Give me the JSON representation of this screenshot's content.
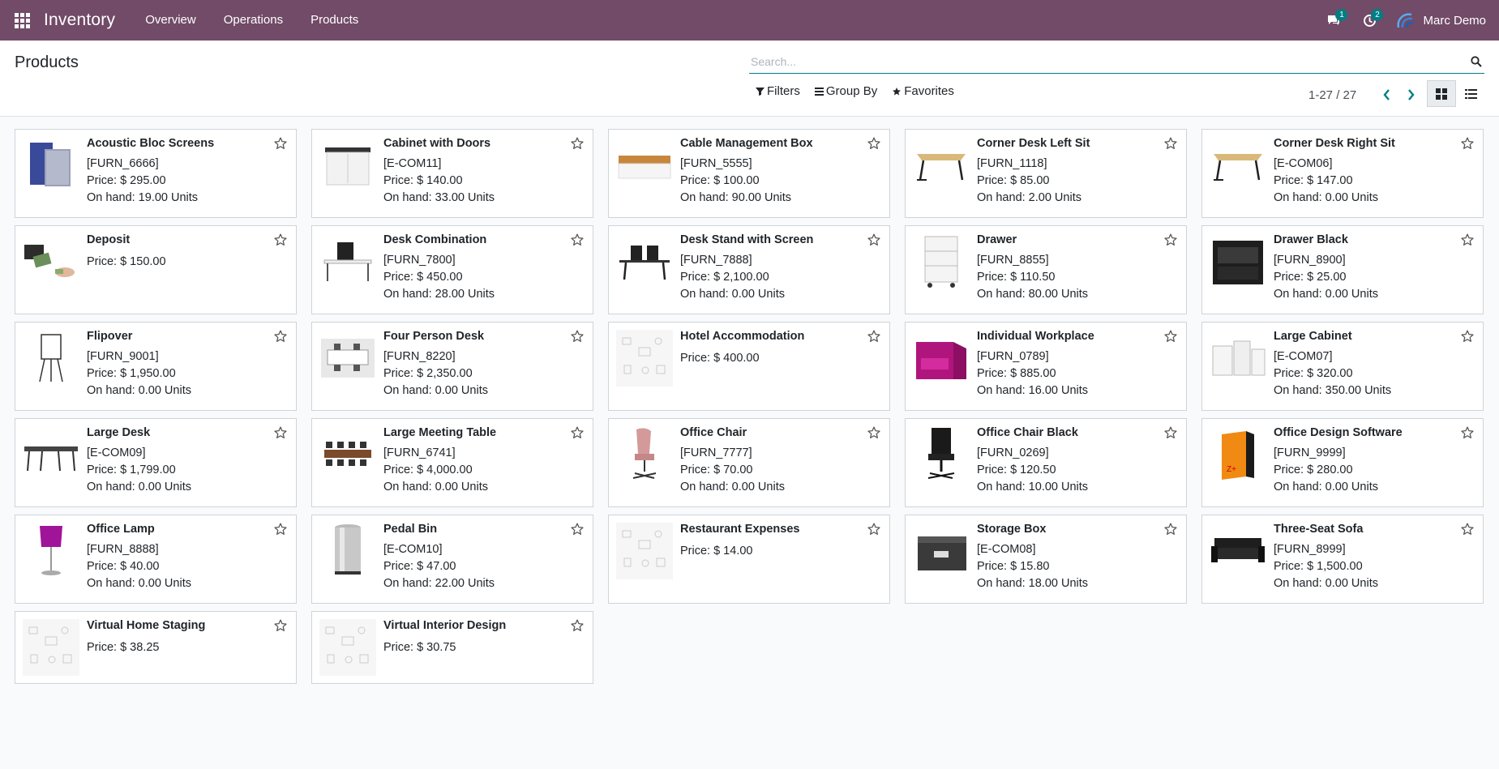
{
  "navbar": {
    "app_name": "Inventory",
    "menu": [
      "Overview",
      "Operations",
      "Products"
    ],
    "messages_count": "1",
    "activities_count": "2",
    "user_name": "Marc Demo",
    "bg_color": "#714b67",
    "badge_color": "#017e84"
  },
  "control_panel": {
    "title": "Products",
    "search_placeholder": "Search...",
    "filters_label": "Filters",
    "group_by_label": "Group By",
    "favorites_label": "Favorites",
    "pager_value": "1-27 / 27"
  },
  "products": [
    {
      "name": "Acoustic Bloc Screens",
      "ref": "[FURN_6666]",
      "price": "Price: $ 295.00",
      "onhand": "On hand: 19.00 Units",
      "icon": "acoustic-screen-image"
    },
    {
      "name": "Cabinet with Doors",
      "ref": "[E-COM11]",
      "price": "Price: $ 140.00",
      "onhand": "On hand: 33.00 Units",
      "icon": "cabinet-image"
    },
    {
      "name": "Cable Management Box",
      "ref": "[FURN_5555]",
      "price": "Price: $ 100.00",
      "onhand": "On hand: 90.00 Units",
      "icon": "cable-box-image"
    },
    {
      "name": "Corner Desk Left Sit",
      "ref": "[FURN_1118]",
      "price": "Price: $ 85.00",
      "onhand": "On hand: 2.00 Units",
      "icon": "desk-image"
    },
    {
      "name": "Corner Desk Right Sit",
      "ref": "[E-COM06]",
      "price": "Price: $ 147.00",
      "onhand": "On hand: 0.00 Units",
      "icon": "desk-image"
    },
    {
      "name": "Deposit",
      "ref": "",
      "price": "Price: $ 150.00",
      "onhand": "",
      "icon": "money-image"
    },
    {
      "name": "Desk Combination",
      "ref": "[FURN_7800]",
      "price": "Price: $ 450.00",
      "onhand": "On hand: 28.00 Units",
      "icon": "desk-combo-image"
    },
    {
      "name": "Desk Stand with Screen",
      "ref": "[FURN_7888]",
      "price": "Price: $ 2,100.00",
      "onhand": "On hand: 0.00 Units",
      "icon": "desk-screen-image"
    },
    {
      "name": "Drawer",
      "ref": "[FURN_8855]",
      "price": "Price: $ 110.50",
      "onhand": "On hand: 80.00 Units",
      "icon": "drawer-image"
    },
    {
      "name": "Drawer Black",
      "ref": "[FURN_8900]",
      "price": "Price: $ 25.00",
      "onhand": "On hand: 0.00 Units",
      "icon": "drawer-black-image"
    },
    {
      "name": "Flipover",
      "ref": "[FURN_9001]",
      "price": "Price: $ 1,950.00",
      "onhand": "On hand: 0.00 Units",
      "icon": "flipchart-image"
    },
    {
      "name": "Four Person Desk",
      "ref": "[FURN_8220]",
      "price": "Price: $ 2,350.00",
      "onhand": "On hand: 0.00 Units",
      "icon": "four-desk-image"
    },
    {
      "name": "Hotel Accommodation",
      "ref": "",
      "price": "Price: $ 400.00",
      "onhand": "",
      "icon": "placeholder-image"
    },
    {
      "name": "Individual Workplace",
      "ref": "[FURN_0789]",
      "price": "Price: $ 885.00",
      "onhand": "On hand: 16.00 Units",
      "icon": "workplace-image"
    },
    {
      "name": "Large Cabinet",
      "ref": "[E-COM07]",
      "price": "Price: $ 320.00",
      "onhand": "On hand: 350.00 Units",
      "icon": "large-cabinet-image"
    },
    {
      "name": "Large Desk",
      "ref": "[E-COM09]",
      "price": "Price: $ 1,799.00",
      "onhand": "On hand: 0.00 Units",
      "icon": "large-desk-image"
    },
    {
      "name": "Large Meeting Table",
      "ref": "[FURN_6741]",
      "price": "Price: $ 4,000.00",
      "onhand": "On hand: 0.00 Units",
      "icon": "meeting-table-image"
    },
    {
      "name": "Office Chair",
      "ref": "[FURN_7777]",
      "price": "Price: $ 70.00",
      "onhand": "On hand: 0.00 Units",
      "icon": "chair-pink-image"
    },
    {
      "name": "Office Chair Black",
      "ref": "[FURN_0269]",
      "price": "Price: $ 120.50",
      "onhand": "On hand: 10.00 Units",
      "icon": "chair-black-image"
    },
    {
      "name": "Office Design Software",
      "ref": "[FURN_9999]",
      "price": "Price: $ 280.00",
      "onhand": "On hand: 0.00 Units",
      "icon": "software-box-image"
    },
    {
      "name": "Office Lamp",
      "ref": "[FURN_8888]",
      "price": "Price: $ 40.00",
      "onhand": "On hand: 0.00 Units",
      "icon": "lamp-image"
    },
    {
      "name": "Pedal Bin",
      "ref": "[E-COM10]",
      "price": "Price: $ 47.00",
      "onhand": "On hand: 22.00 Units",
      "icon": "bin-image"
    },
    {
      "name": "Restaurant Expenses",
      "ref": "",
      "price": "Price: $ 14.00",
      "onhand": "",
      "icon": "placeholder-image"
    },
    {
      "name": "Storage Box",
      "ref": "[E-COM08]",
      "price": "Price: $ 15.80",
      "onhand": "On hand: 18.00 Units",
      "icon": "storage-box-image"
    },
    {
      "name": "Three-Seat Sofa",
      "ref": "[FURN_8999]",
      "price": "Price: $ 1,500.00",
      "onhand": "On hand: 0.00 Units",
      "icon": "sofa-image"
    },
    {
      "name": "Virtual Home Staging",
      "ref": "",
      "price": "Price: $ 38.25",
      "onhand": "",
      "icon": "placeholder-image"
    },
    {
      "name": "Virtual Interior Design",
      "ref": "",
      "price": "Price: $ 30.75",
      "onhand": "",
      "icon": "placeholder-image"
    }
  ]
}
